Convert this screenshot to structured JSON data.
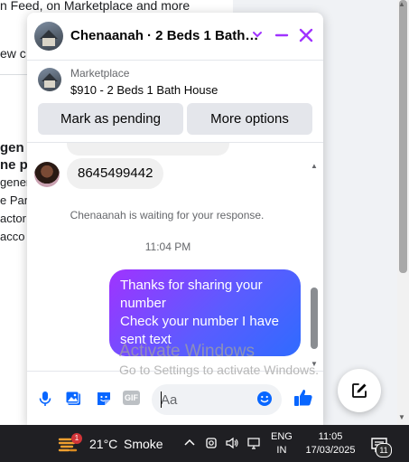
{
  "background_page": {
    "line_1": "n Feed, on Marketplace and more",
    "line_2": "ew c",
    "bold_1": "gen",
    "bold_2": "ne pa",
    "line_3": "gener",
    "line_4": "e Par",
    "line_5": "actor",
    "line_6": "acco"
  },
  "chat": {
    "header": {
      "title": "Chenaanah · 2 Beds 1 Bath…",
      "options_icon": "chevron-down-icon",
      "minimize_icon": "minimize-icon",
      "close_icon": "close-icon",
      "accent_color": "#a033ff"
    },
    "listing": {
      "kind": "Marketplace",
      "title": "$910 - 2 Beds 1 Bath House",
      "mark_pending_label": "Mark as pending",
      "more_options_label": "More options"
    },
    "messages": {
      "incoming_text": "8645499442",
      "system_note": "Chenaanah is waiting for your response.",
      "timestamp": "11:04 PM",
      "outgoing_lines": [
        "Thanks for sharing your",
        "number",
        "Check your number I have",
        "sent text"
      ]
    },
    "composer": {
      "placeholder": "Aa",
      "icons": [
        "microphone-icon",
        "photo-icon",
        "sticker-icon",
        "gif-icon",
        "emoji-icon",
        "like-icon"
      ],
      "gif_label": "GIF"
    }
  },
  "watermark": {
    "title": "Activate Windows",
    "subtitle": "Go to Settings to activate Windows."
  },
  "taskbar": {
    "weather_badge": "1",
    "temperature": "21°C",
    "condition": "Smoke",
    "language_top": "ENG",
    "language_bottom": "IN",
    "time": "11:05",
    "date": "17/03/2025",
    "notification_count": "11"
  }
}
